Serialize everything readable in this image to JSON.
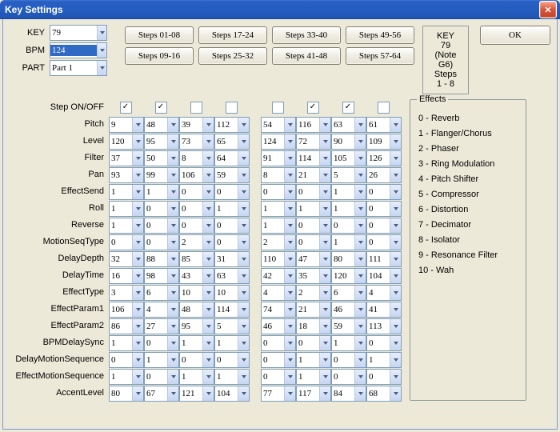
{
  "window": {
    "title": "Key Settings"
  },
  "controls": {
    "key_label": "KEY",
    "key_value": "79",
    "bpm_label": "BPM",
    "bpm_value": "124",
    "part_label": "PART",
    "part_value": "Part 1"
  },
  "step_buttons": [
    "Steps 01-08",
    "Steps 17-24",
    "Steps 33-40",
    "Steps 49-56",
    "Steps 09-16",
    "Steps 25-32",
    "Steps 41-48",
    "Steps 57-64"
  ],
  "status": {
    "line1": "KEY 79",
    "line2": "(Note  G6)",
    "line3": "Steps 1 - 8"
  },
  "ok_label": "OK",
  "step_onoff_label": "Step ON/OFF",
  "step_onoff": [
    true,
    true,
    false,
    false,
    false,
    true,
    true,
    false
  ],
  "row_labels": [
    "Pitch",
    "Level",
    "Filter",
    "Pan",
    "EffectSend",
    "Roll",
    "Reverse",
    "MotionSeqType",
    "DelayDepth",
    "DelayTime",
    "EffectType",
    "EffectParam1",
    "EffectParam2",
    "BPMDelaySync",
    "DelayMotionSequence",
    "EffectMotionSequence",
    "AccentLevel"
  ],
  "rows": [
    [
      "9",
      "48",
      "39",
      "112",
      "54",
      "116",
      "63",
      "61"
    ],
    [
      "120",
      "95",
      "73",
      "65",
      "124",
      "72",
      "90",
      "109"
    ],
    [
      "37",
      "50",
      "8",
      "64",
      "91",
      "114",
      "105",
      "126"
    ],
    [
      "93",
      "99",
      "106",
      "59",
      "8",
      "21",
      "5",
      "26"
    ],
    [
      "1",
      "1",
      "0",
      "0",
      "0",
      "0",
      "1",
      "0"
    ],
    [
      "1",
      "0",
      "0",
      "1",
      "1",
      "1",
      "1",
      "0"
    ],
    [
      "1",
      "0",
      "0",
      "0",
      "1",
      "0",
      "0",
      "0"
    ],
    [
      "0",
      "0",
      "2",
      "0",
      "2",
      "0",
      "1",
      "0"
    ],
    [
      "32",
      "88",
      "85",
      "31",
      "110",
      "47",
      "80",
      "111"
    ],
    [
      "16",
      "98",
      "43",
      "63",
      "42",
      "35",
      "120",
      "104"
    ],
    [
      "3",
      "6",
      "10",
      "10",
      "4",
      "2",
      "6",
      "4"
    ],
    [
      "106",
      "4",
      "48",
      "114",
      "74",
      "21",
      "46",
      "41"
    ],
    [
      "86",
      "27",
      "95",
      "5",
      "46",
      "18",
      "59",
      "113"
    ],
    [
      "1",
      "0",
      "1",
      "1",
      "0",
      "0",
      "1",
      "0"
    ],
    [
      "0",
      "1",
      "0",
      "0",
      "0",
      "1",
      "0",
      "1"
    ],
    [
      "1",
      "0",
      "1",
      "1",
      "0",
      "1",
      "0",
      "0"
    ],
    [
      "80",
      "67",
      "121",
      "104",
      "77",
      "117",
      "84",
      "68"
    ]
  ],
  "effects": {
    "title": "Effects",
    "items": [
      "0 - Reverb",
      "1 - Flanger/Chorus",
      "2 - Phaser",
      "3 - Ring Modulation",
      "4 - Pitch Shifter",
      "5 - Compressor",
      "6 - Distortion",
      "7 - Decimator",
      "8 - Isolator",
      "9 - Resonance Filter",
      "10 - Wah"
    ]
  }
}
